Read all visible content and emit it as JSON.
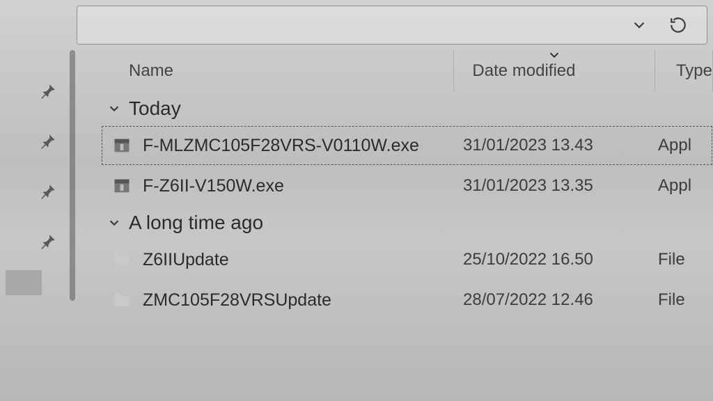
{
  "toolbar": {
    "history_dropdown": "history",
    "refresh": "refresh"
  },
  "columns": {
    "name": "Name",
    "date": "Date modified",
    "type": "Type"
  },
  "groups": [
    {
      "label": "Today",
      "items": [
        {
          "icon": "archive",
          "name": "F-MLZMC105F28VRS-V0110W.exe",
          "date": "31/01/2023 13.43",
          "type": "Appl",
          "selected": true
        },
        {
          "icon": "archive",
          "name": "F-Z6II-V150W.exe",
          "date": "31/01/2023 13.35",
          "type": "Appl",
          "selected": false
        }
      ]
    },
    {
      "label": "A long time ago",
      "items": [
        {
          "icon": "folder",
          "name": "Z6IIUpdate",
          "date": "25/10/2022 16.50",
          "type": "File",
          "selected": false
        },
        {
          "icon": "folder",
          "name": "ZMC105F28VRSUpdate",
          "date": "28/07/2022 12.46",
          "type": "File",
          "selected": false
        }
      ]
    }
  ]
}
